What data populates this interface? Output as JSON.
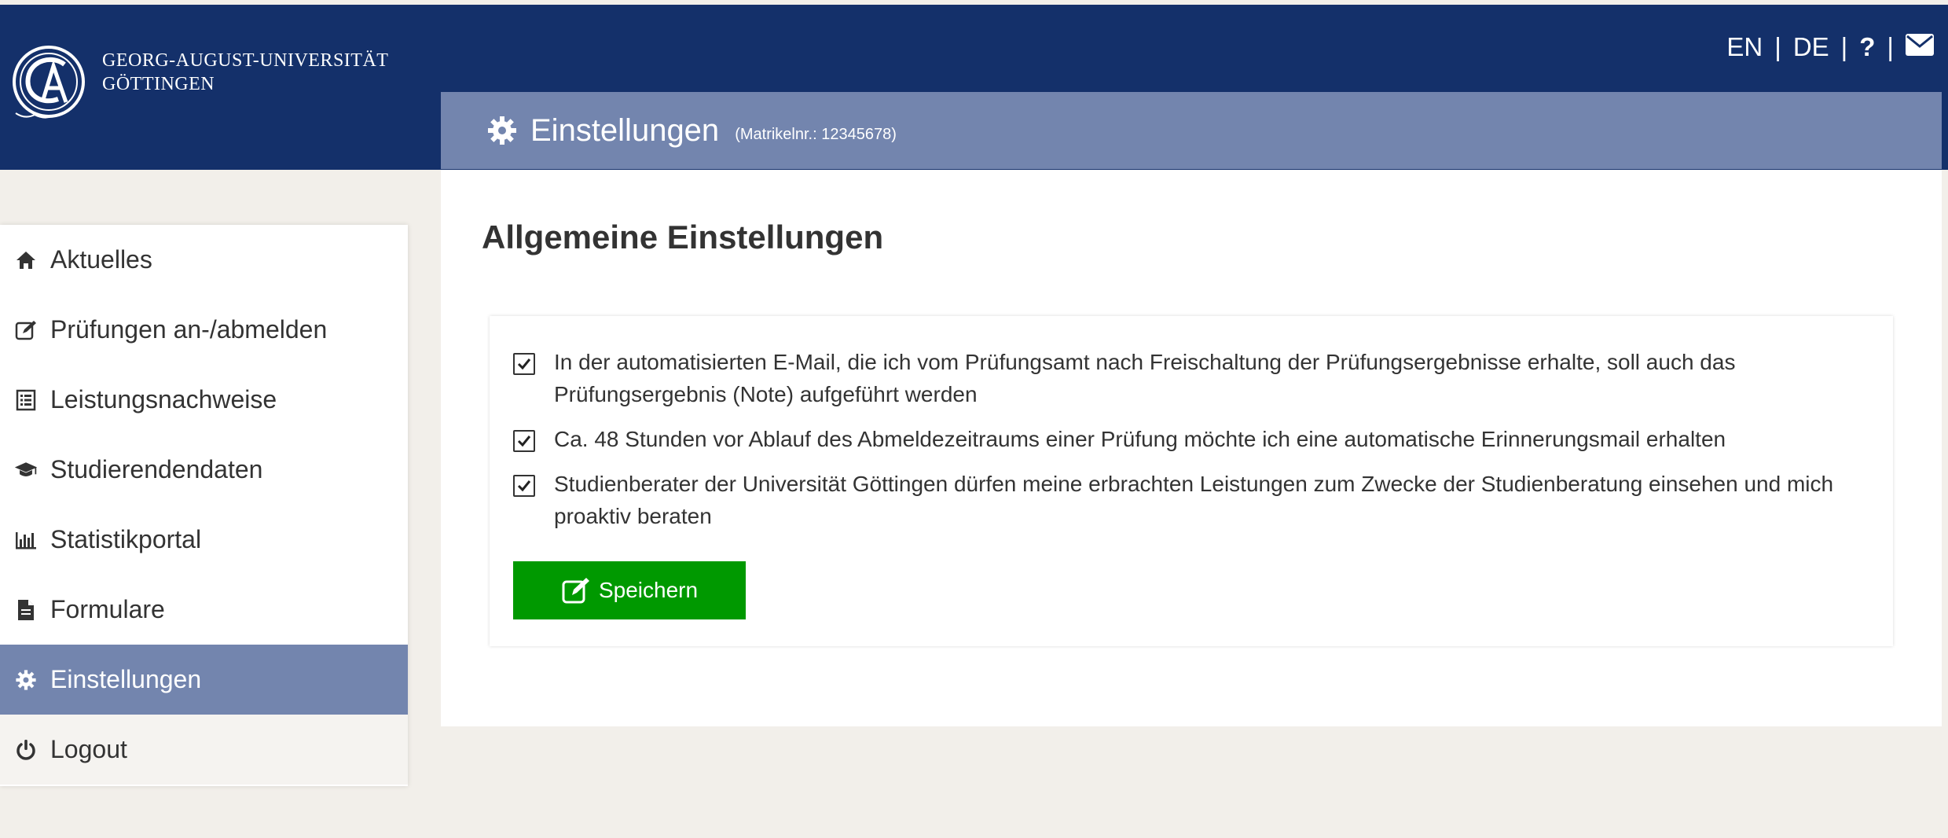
{
  "header": {
    "university_line1": "GEORG-AUGUST-UNIVERSITÄT",
    "university_line2": "GÖTTINGEN",
    "lang_en": "EN",
    "lang_de": "DE",
    "separator": "|",
    "help_label": "?",
    "brand_color": "#14306a",
    "accent_color": "#7385ae"
  },
  "page": {
    "title": "Einstellungen",
    "matrikel": "(Matrikelnr.: 12345678)"
  },
  "sidebar": {
    "items": [
      {
        "label": "Aktuelles",
        "icon": "home-icon"
      },
      {
        "label": "Prüfungen an-/abmelden",
        "icon": "edit-icon"
      },
      {
        "label": "Leistungsnachweise",
        "icon": "list-icon"
      },
      {
        "label": "Studierendendaten",
        "icon": "graduation-cap-icon"
      },
      {
        "label": "Statistikportal",
        "icon": "bar-chart-icon"
      },
      {
        "label": "Formulare",
        "icon": "document-icon"
      },
      {
        "label": "Einstellungen",
        "icon": "gear-icon",
        "active": true
      },
      {
        "label": "Logout",
        "icon": "power-icon"
      }
    ]
  },
  "main": {
    "heading": "Allgemeine Einstellungen",
    "options": [
      {
        "text": "In der automatisierten E-Mail, die ich vom Prüfungsamt nach Freischaltung der Prüfungsergebnisse erhalte, soll auch das Prüfungsergebnis (Note) aufgeführt werden",
        "checked": true
      },
      {
        "text": "Ca. 48 Stunden vor Ablauf des Abmeldezeitraums einer Prüfung möchte ich eine automatische Erinnerungsmail erhalten",
        "checked": true
      },
      {
        "text": "Studienberater der Universität Göttingen dürfen meine erbrachten Leistungen zum Zwecke der Studienberatung einsehen und mich proaktiv beraten",
        "checked": true
      }
    ],
    "save_label": "Speichern",
    "save_color": "#009900"
  }
}
